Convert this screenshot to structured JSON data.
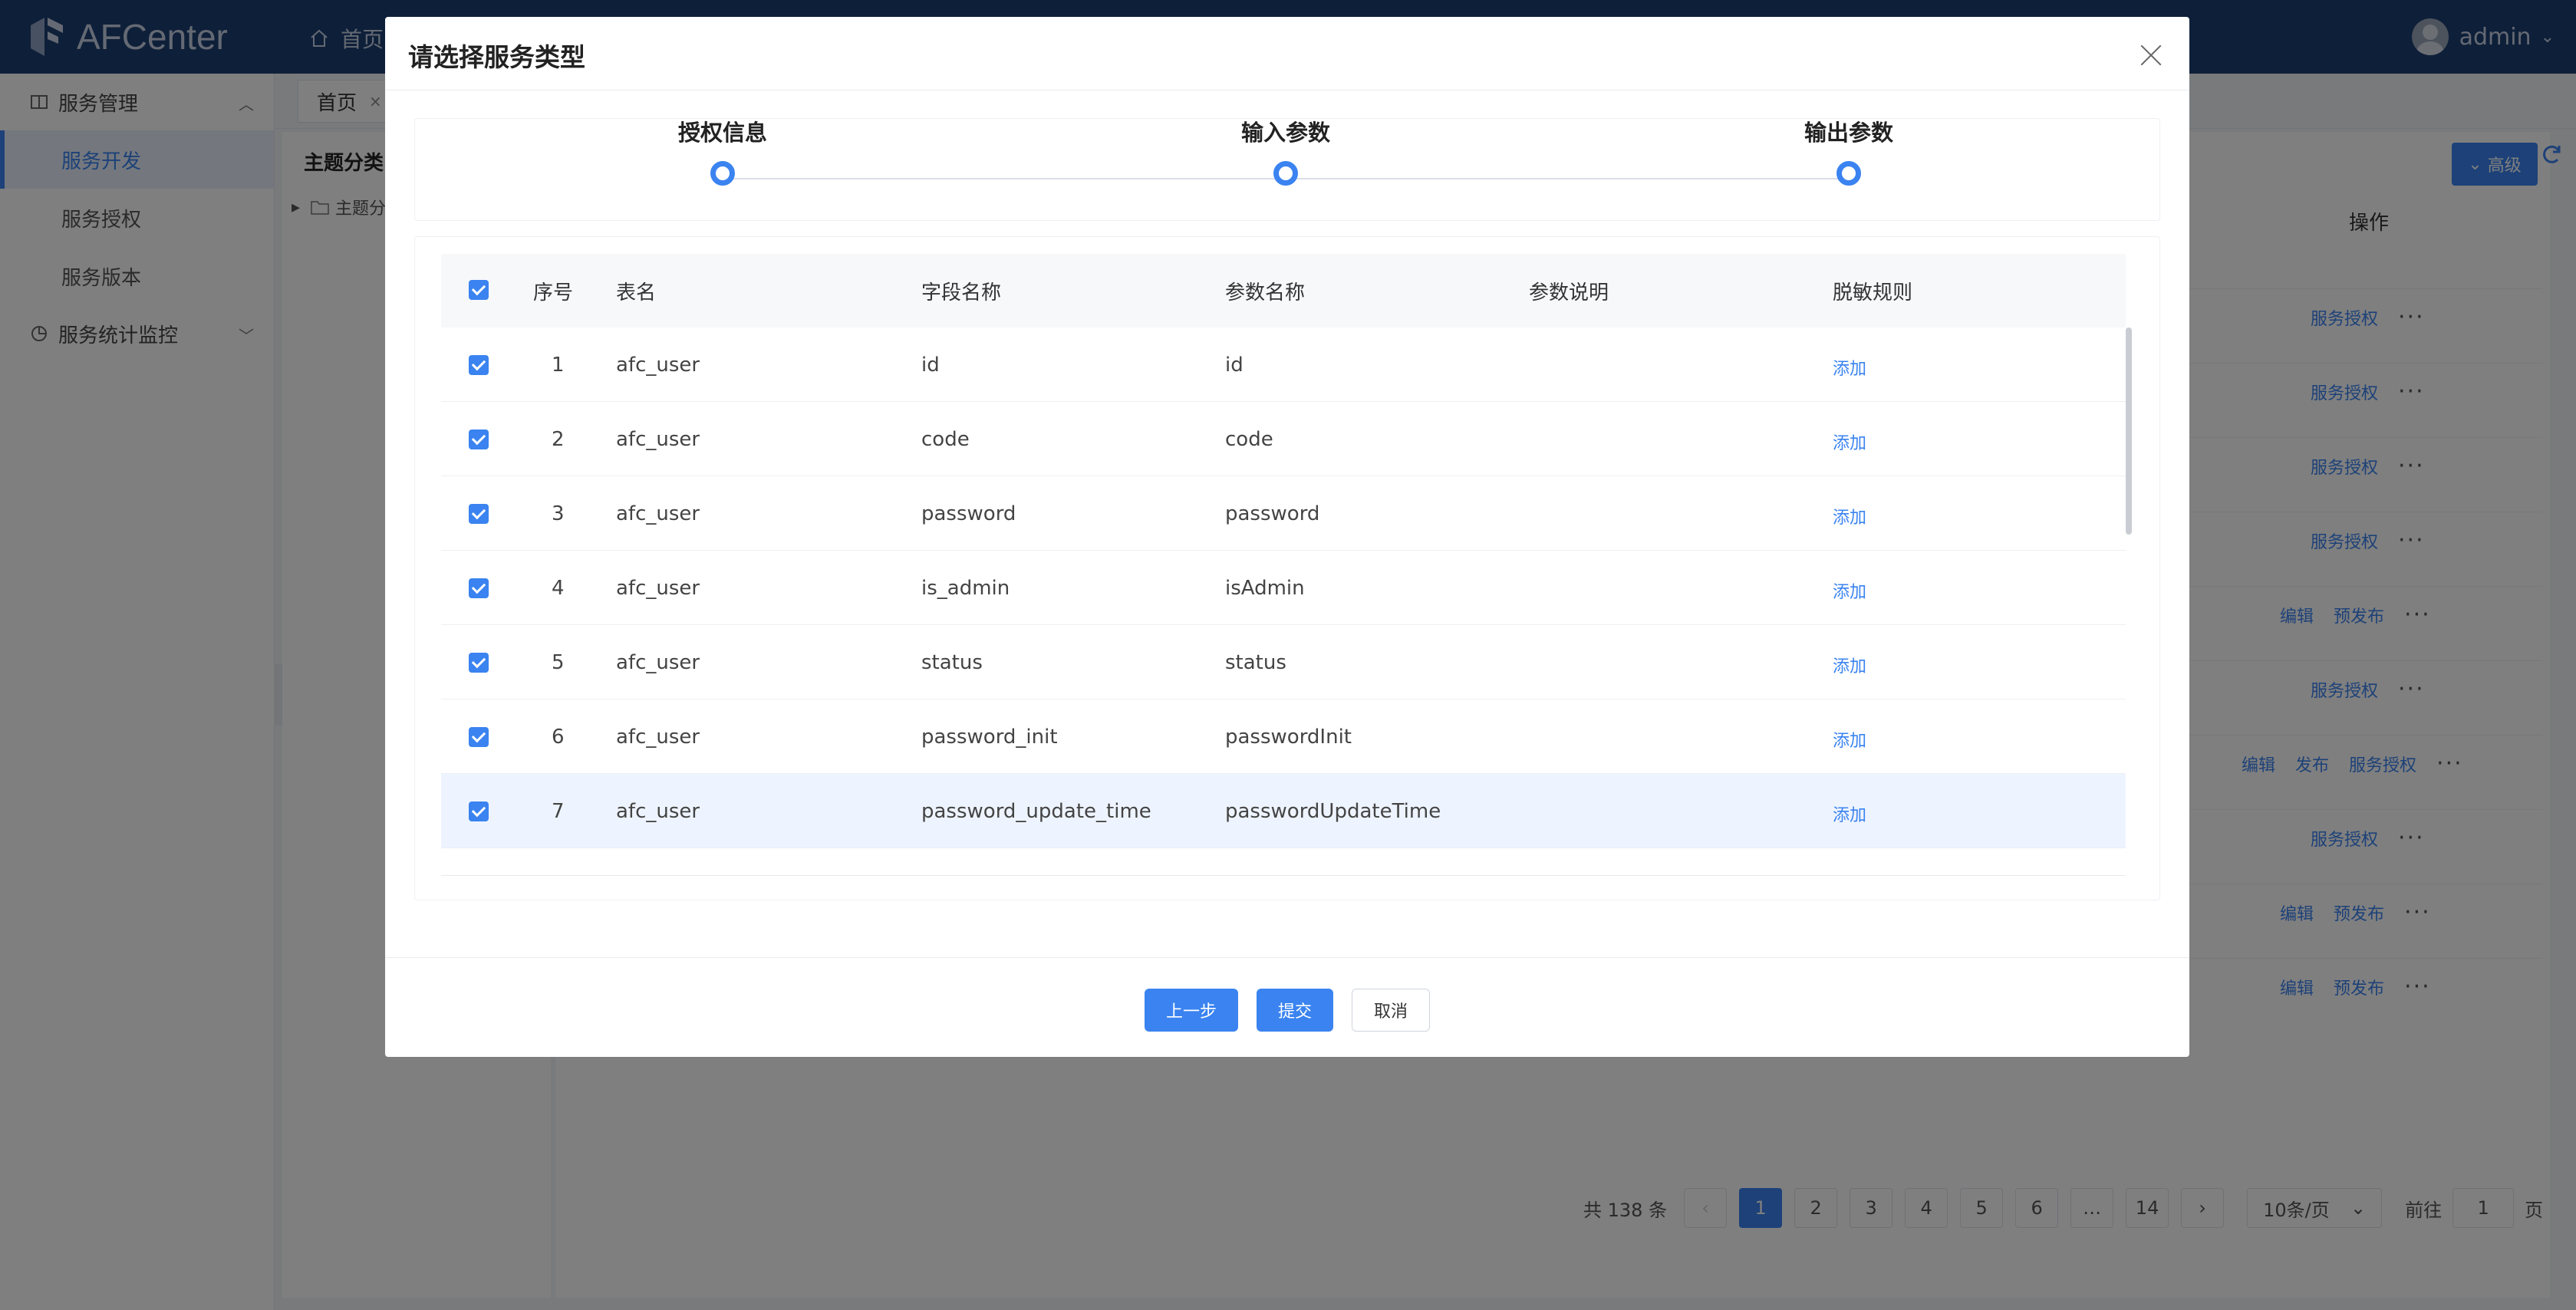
{
  "app": {
    "logo_text": "AFCenter",
    "home_nav": "首页",
    "user_name": "admin"
  },
  "sidebar": {
    "group1": "服务管理",
    "items": [
      {
        "label": "服务开发",
        "active": true
      },
      {
        "label": "服务授权",
        "active": false
      },
      {
        "label": "服务版本",
        "active": false
      }
    ],
    "group2": "服务统计监控"
  },
  "tabs": {
    "home_tab": "首页"
  },
  "tree": {
    "title": "主题分类",
    "root_node": "主题分"
  },
  "main": {
    "adv_button": "高级",
    "op_header": "操作",
    "rows_ops": [
      [
        "服务授权"
      ],
      [
        "服务授权"
      ],
      [
        "服务授权"
      ],
      [
        "服务授权"
      ],
      [
        "编辑",
        "预发布"
      ],
      [
        "服务授权"
      ],
      [
        "编辑",
        "发布",
        "服务授权"
      ],
      [
        "服务授权"
      ],
      [
        "编辑",
        "预发布"
      ],
      [
        "编辑",
        "预发布"
      ]
    ]
  },
  "pagination": {
    "total": "共 138 条",
    "pages": [
      "1",
      "2",
      "3",
      "4",
      "5",
      "6",
      "…",
      "14"
    ],
    "current": "1",
    "page_size": "10条/页",
    "jump_prefix": "前往",
    "jump_value": "1",
    "jump_suffix": "页"
  },
  "modal": {
    "title": "请选择服务类型",
    "steps": [
      "授权信息",
      "输入参数",
      "输出参数"
    ],
    "columns": [
      "序号",
      "表名",
      "字段名称",
      "参数名称",
      "参数说明",
      "脱敏规则"
    ],
    "rows": [
      {
        "no": "1",
        "table": "afc_user",
        "field": "id",
        "param": "id",
        "desc": "",
        "rule": "添加"
      },
      {
        "no": "2",
        "table": "afc_user",
        "field": "code",
        "param": "code",
        "desc": "",
        "rule": "添加"
      },
      {
        "no": "3",
        "table": "afc_user",
        "field": "password",
        "param": "password",
        "desc": "",
        "rule": "添加"
      },
      {
        "no": "4",
        "table": "afc_user",
        "field": "is_admin",
        "param": "isAdmin",
        "desc": "",
        "rule": "添加"
      },
      {
        "no": "5",
        "table": "afc_user",
        "field": "status",
        "param": "status",
        "desc": "",
        "rule": "添加"
      },
      {
        "no": "6",
        "table": "afc_user",
        "field": "password_init",
        "param": "passwordInit",
        "desc": "",
        "rule": "添加"
      },
      {
        "no": "7",
        "table": "afc_user",
        "field": "password_update_time",
        "param": "passwordUpdateTime",
        "desc": "",
        "rule": "添加"
      }
    ],
    "buttons": {
      "prev": "上一步",
      "submit": "提交",
      "cancel": "取消"
    }
  },
  "colors": {
    "primary": "#3a83f0",
    "topbar": "#1d3f73",
    "mask": "rgba(0,0,0,0.5)"
  }
}
